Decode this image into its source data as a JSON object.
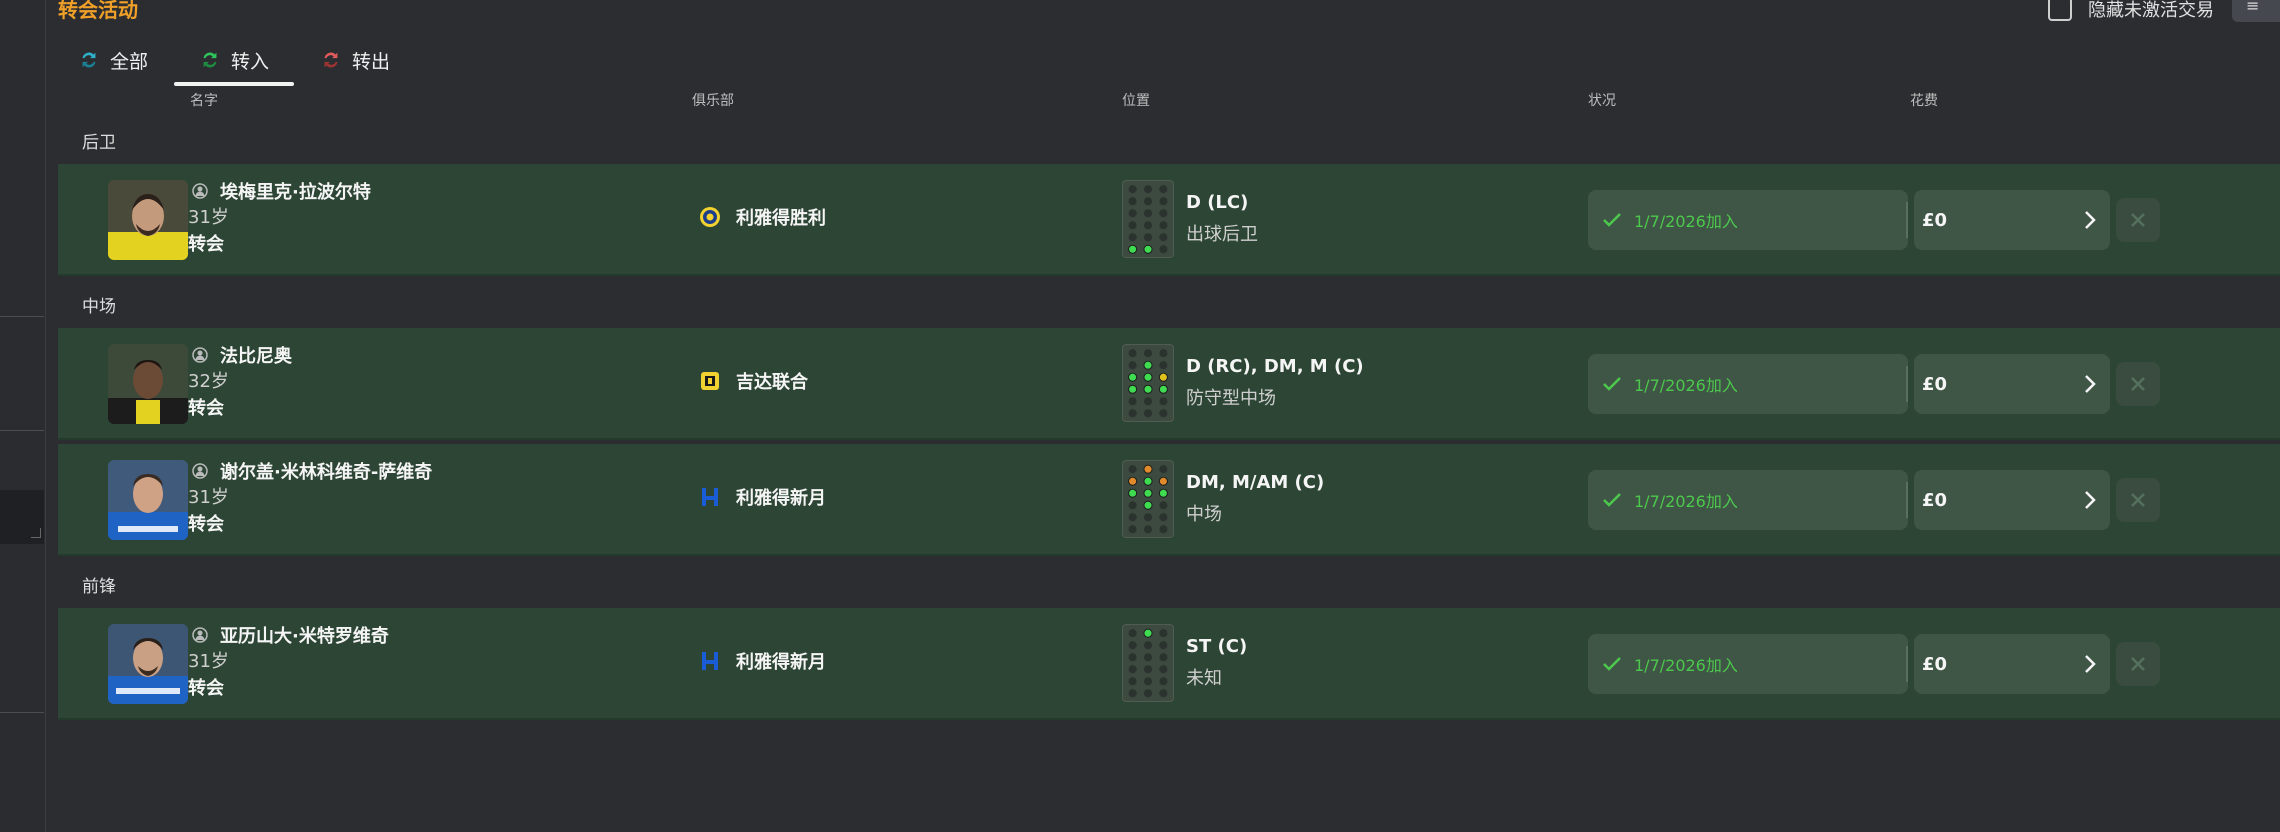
{
  "page": {
    "title": "转会活动"
  },
  "toolbar": {
    "hide_inactive_label": "隐藏未激活交易"
  },
  "tabs": [
    {
      "label": "全部",
      "color": "#2fb1c9"
    },
    {
      "label": "转入",
      "color": "#2ec55a"
    },
    {
      "label": "转出",
      "color": "#e05b5b"
    }
  ],
  "columns": {
    "name": "名字",
    "club": "俱乐部",
    "position": "位置",
    "status": "状况",
    "fee": "花费"
  },
  "groups": [
    {
      "label": "后卫",
      "players": [
        {
          "name": "埃梅里克·拉波尔特",
          "age": "31岁",
          "type": "转会",
          "club": "利雅得胜利",
          "club_icon": "al-nassr-crest-icon",
          "position_code": "D (LC)",
          "role": "出球后卫",
          "status": "1/7/2026加入",
          "fee": "£0"
        }
      ]
    },
    {
      "label": "中场",
      "players": [
        {
          "name": "法比尼奥",
          "age": "32岁",
          "type": "转会",
          "club": "吉达联合",
          "club_icon": "al-ittihad-crest-icon",
          "position_code": "D (RC), DM, M (C)",
          "role": "防守型中场",
          "status": "1/7/2026加入",
          "fee": "£0"
        },
        {
          "name": "谢尔盖·米林科维奇-萨维奇",
          "age": "31岁",
          "type": "转会",
          "club": "利雅得新月",
          "club_icon": "al-hilal-crest-icon",
          "position_code": "DM, M/AM (C)",
          "role": "中场",
          "status": "1/7/2026加入",
          "fee": "£0"
        }
      ]
    },
    {
      "label": "前锋",
      "players": [
        {
          "name": "亚历山大·米特罗维奇",
          "age": "31岁",
          "type": "转会",
          "club": "利雅得新月",
          "club_icon": "al-hilal-crest-icon",
          "position_code": "ST (C)",
          "role": "未知",
          "status": "1/7/2026加入",
          "fee": "£0"
        }
      ]
    }
  ],
  "colors": {
    "accent": "#f0a028",
    "row_bg": "#2c4534",
    "status_green": "#4cc94c"
  }
}
